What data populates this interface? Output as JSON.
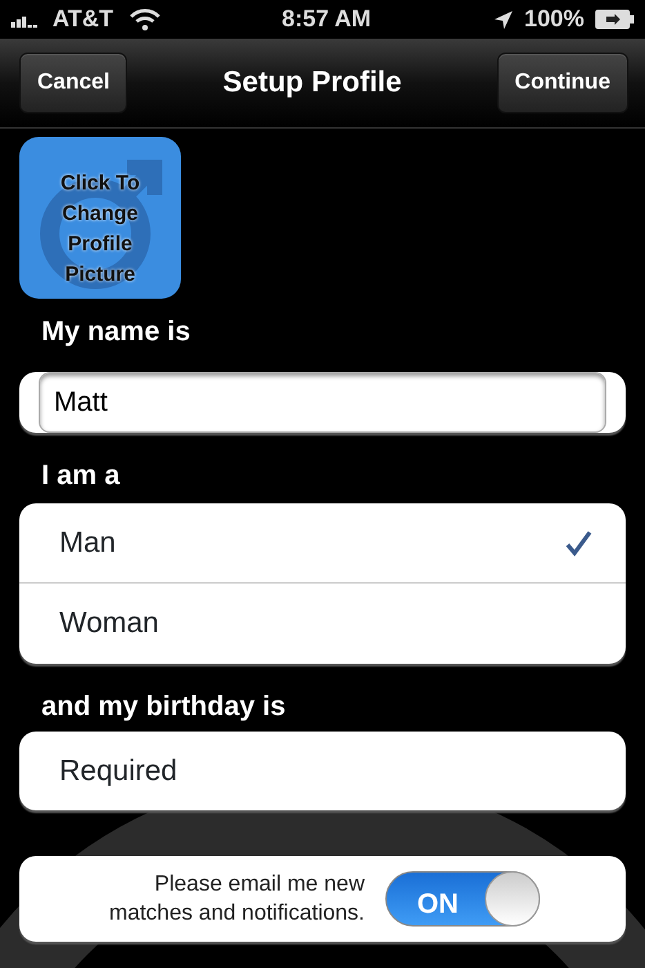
{
  "status_bar": {
    "carrier": "AT&T",
    "time": "8:57 AM",
    "battery": "100%"
  },
  "nav_bar": {
    "left_button": "Cancel",
    "title": "Setup Profile",
    "right_button": "Continue"
  },
  "profile_picture": {
    "label": "Click To Change Profile Picture"
  },
  "name_section": {
    "label": "My name is",
    "value": "Matt"
  },
  "gender_section": {
    "label": "I am a",
    "options": [
      {
        "label": "Man",
        "selected": true
      },
      {
        "label": "Woman",
        "selected": false
      }
    ]
  },
  "birthday_section": {
    "label": "and my birthday is",
    "value": "Required"
  },
  "notifications": {
    "label": "Please email me new matches and notifications.",
    "toggle_text": "ON",
    "on": true
  }
}
